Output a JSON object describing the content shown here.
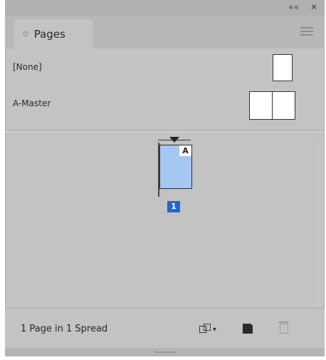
{
  "window": {
    "collapse_label": "««",
    "close_label": "✕"
  },
  "panel": {
    "tab_label": "Pages",
    "tab_chevron": "◇",
    "menu_icon": "hamburger-icon"
  },
  "masters": [
    {
      "label": "[None]",
      "thumb": "single"
    },
    {
      "label": "A-Master",
      "thumb": "spread"
    }
  ],
  "document": {
    "page_master_letter": "A",
    "page_number": "1"
  },
  "footer": {
    "status": "1 Page in 1 Spread",
    "buttons": [
      {
        "name": "edit-page-size-button",
        "icon": "edit-page-size-icon"
      },
      {
        "name": "new-page-button",
        "icon": "new-page-icon"
      },
      {
        "name": "delete-page-button",
        "icon": "trash-icon"
      }
    ]
  }
}
